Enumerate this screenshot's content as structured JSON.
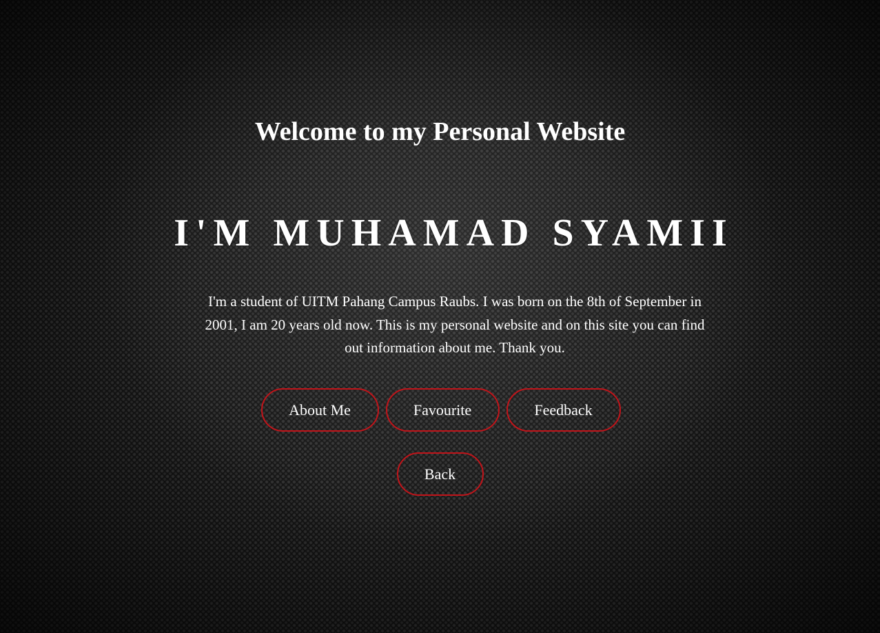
{
  "header": {
    "welcome": "Welcome to my Personal Website",
    "name": "I'M MUHAMAD SYAMII"
  },
  "bio": {
    "text": "I'm a student of UITM Pahang Campus Raubs. I was born on the 8th of September in 2001, I am 20 years old now. This is my personal website and on this site you can find out information about me. Thank you."
  },
  "nav": {
    "about_label": "About Me",
    "favourite_label": "Favourite",
    "feedback_label": "Feedback",
    "back_label": "Back"
  },
  "colors": {
    "accent": "#c3141a",
    "text": "#ffffff",
    "background": "#1a1a1a"
  }
}
